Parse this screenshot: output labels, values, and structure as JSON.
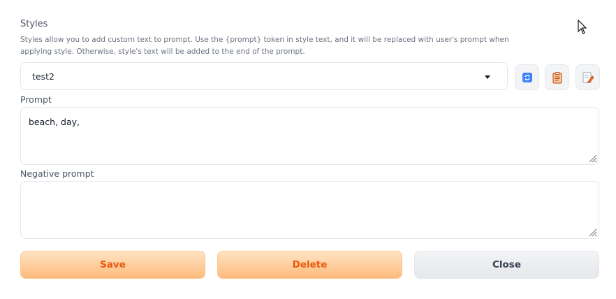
{
  "styles": {
    "title": "Styles",
    "description": "Styles allow you to add custom text to prompt. Use the {prompt} token in style text, and it will be replaced with user's prompt when applying style. Otherwise, style's text will be added to the end of the prompt.",
    "selected": "test2",
    "tools": [
      "refresh-icon",
      "clipboard-icon",
      "edit-icon"
    ]
  },
  "prompt": {
    "label": "Prompt",
    "value": "beach, day,"
  },
  "negative_prompt": {
    "label": "Negative prompt",
    "value": ""
  },
  "actions": {
    "save": "Save",
    "delete": "Delete",
    "close": "Close"
  },
  "colors": {
    "primary_text": "#ea580c",
    "primary_bg": "#fdbb7d",
    "secondary_bg": "#e5e7eb"
  }
}
